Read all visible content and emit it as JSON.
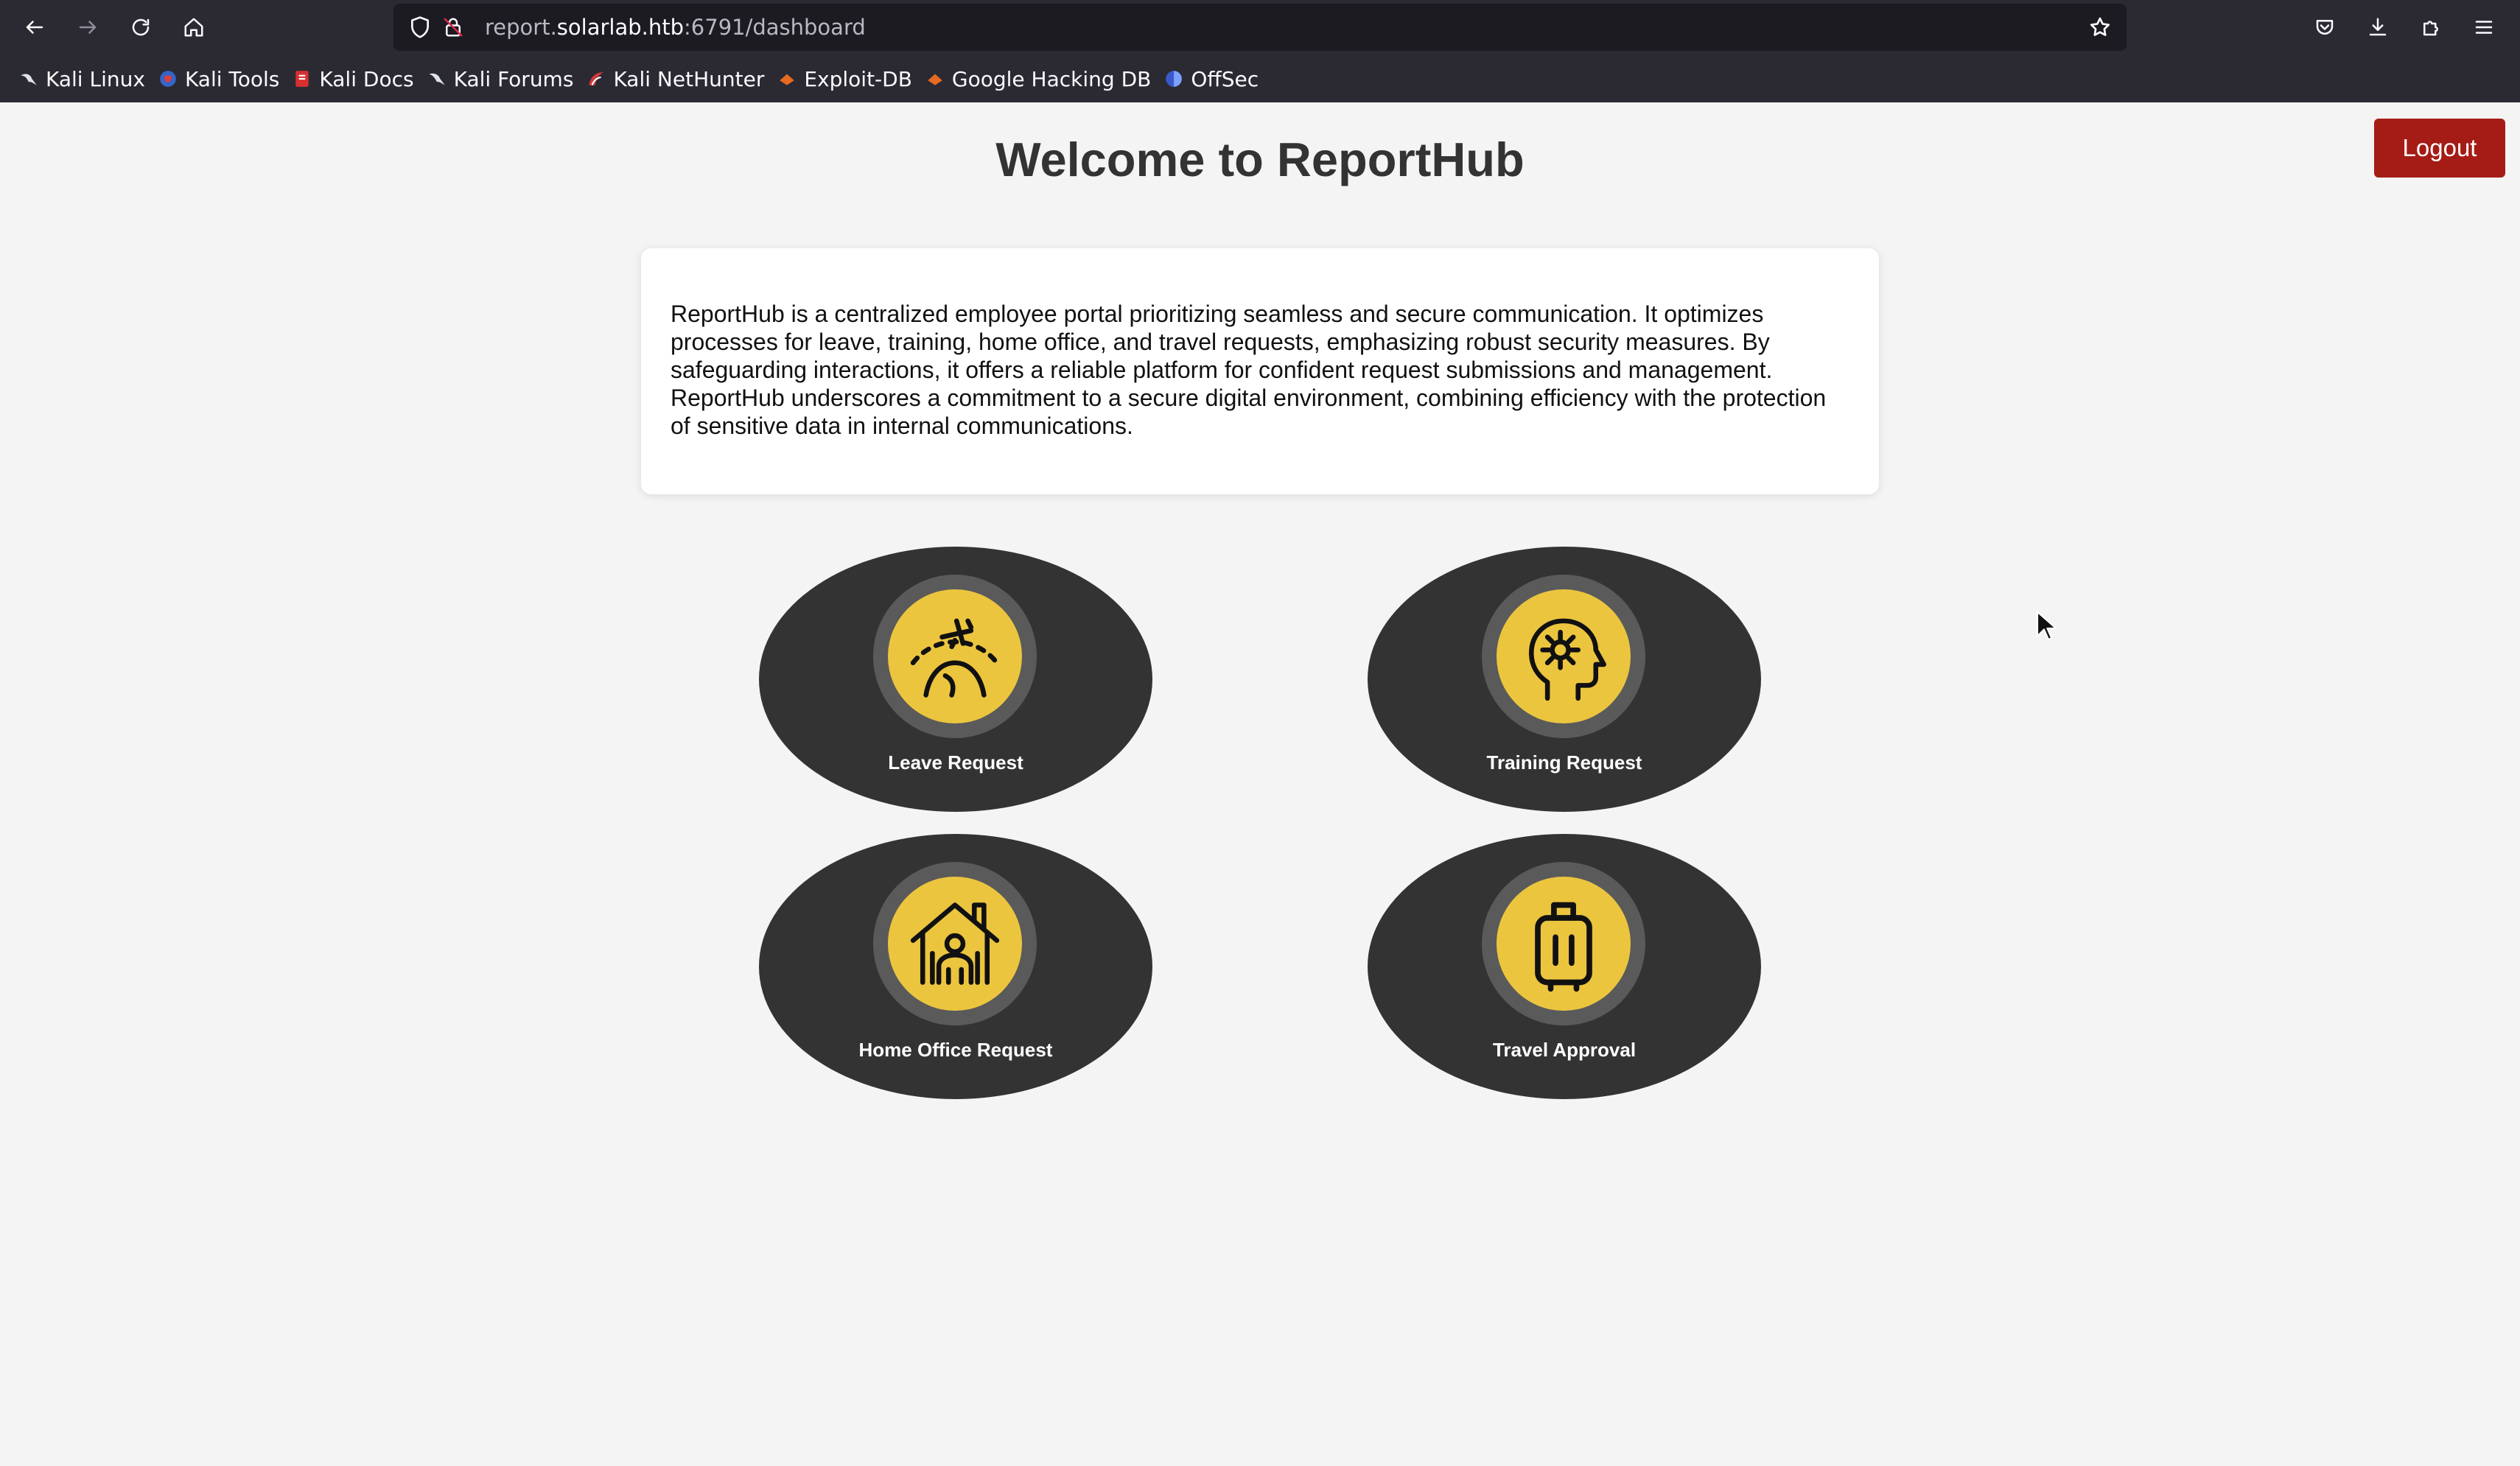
{
  "browser": {
    "url_prefix": "report.",
    "url_domain": "solarlab.htb",
    "url_suffix": ":6791/dashboard",
    "bookmarks": [
      {
        "label": "Kali Linux",
        "icon": "kali-dragon-icon"
      },
      {
        "label": "Kali Tools",
        "icon": "kali-tools-icon"
      },
      {
        "label": "Kali Docs",
        "icon": "kali-docs-icon"
      },
      {
        "label": "Kali Forums",
        "icon": "kali-forums-icon"
      },
      {
        "label": "Kali NetHunter",
        "icon": "nethunter-icon"
      },
      {
        "label": "Exploit-DB",
        "icon": "exploit-db-icon"
      },
      {
        "label": "Google Hacking DB",
        "icon": "ghdb-icon"
      },
      {
        "label": "OffSec",
        "icon": "offsec-icon"
      }
    ]
  },
  "page": {
    "title": "Welcome to ReportHub",
    "logout_label": "Logout",
    "intro": "ReportHub is a centralized employee portal prioritizing seamless and secure communication. It optimizes processes for leave, training, home office, and travel requests, emphasizing robust security measures. By safeguarding interactions, it offers a reliable platform for confident request submissions and management. ReportHub underscores a commitment to a secure digital environment, combining efficiency with the protection of sensitive data in internal communications.",
    "tiles": [
      {
        "label": "Leave Request",
        "icon": "airplane-globe-icon"
      },
      {
        "label": "Training Request",
        "icon": "head-gear-icon"
      },
      {
        "label": "Home Office Request",
        "icon": "house-people-icon"
      },
      {
        "label": "Travel Approval",
        "icon": "luggage-icon"
      }
    ]
  },
  "colors": {
    "logout_bg": "#a51b15",
    "tile_bg": "#333333",
    "tile_ring": "#5a5a5a",
    "tile_icon_bg": "#ecc53f"
  }
}
